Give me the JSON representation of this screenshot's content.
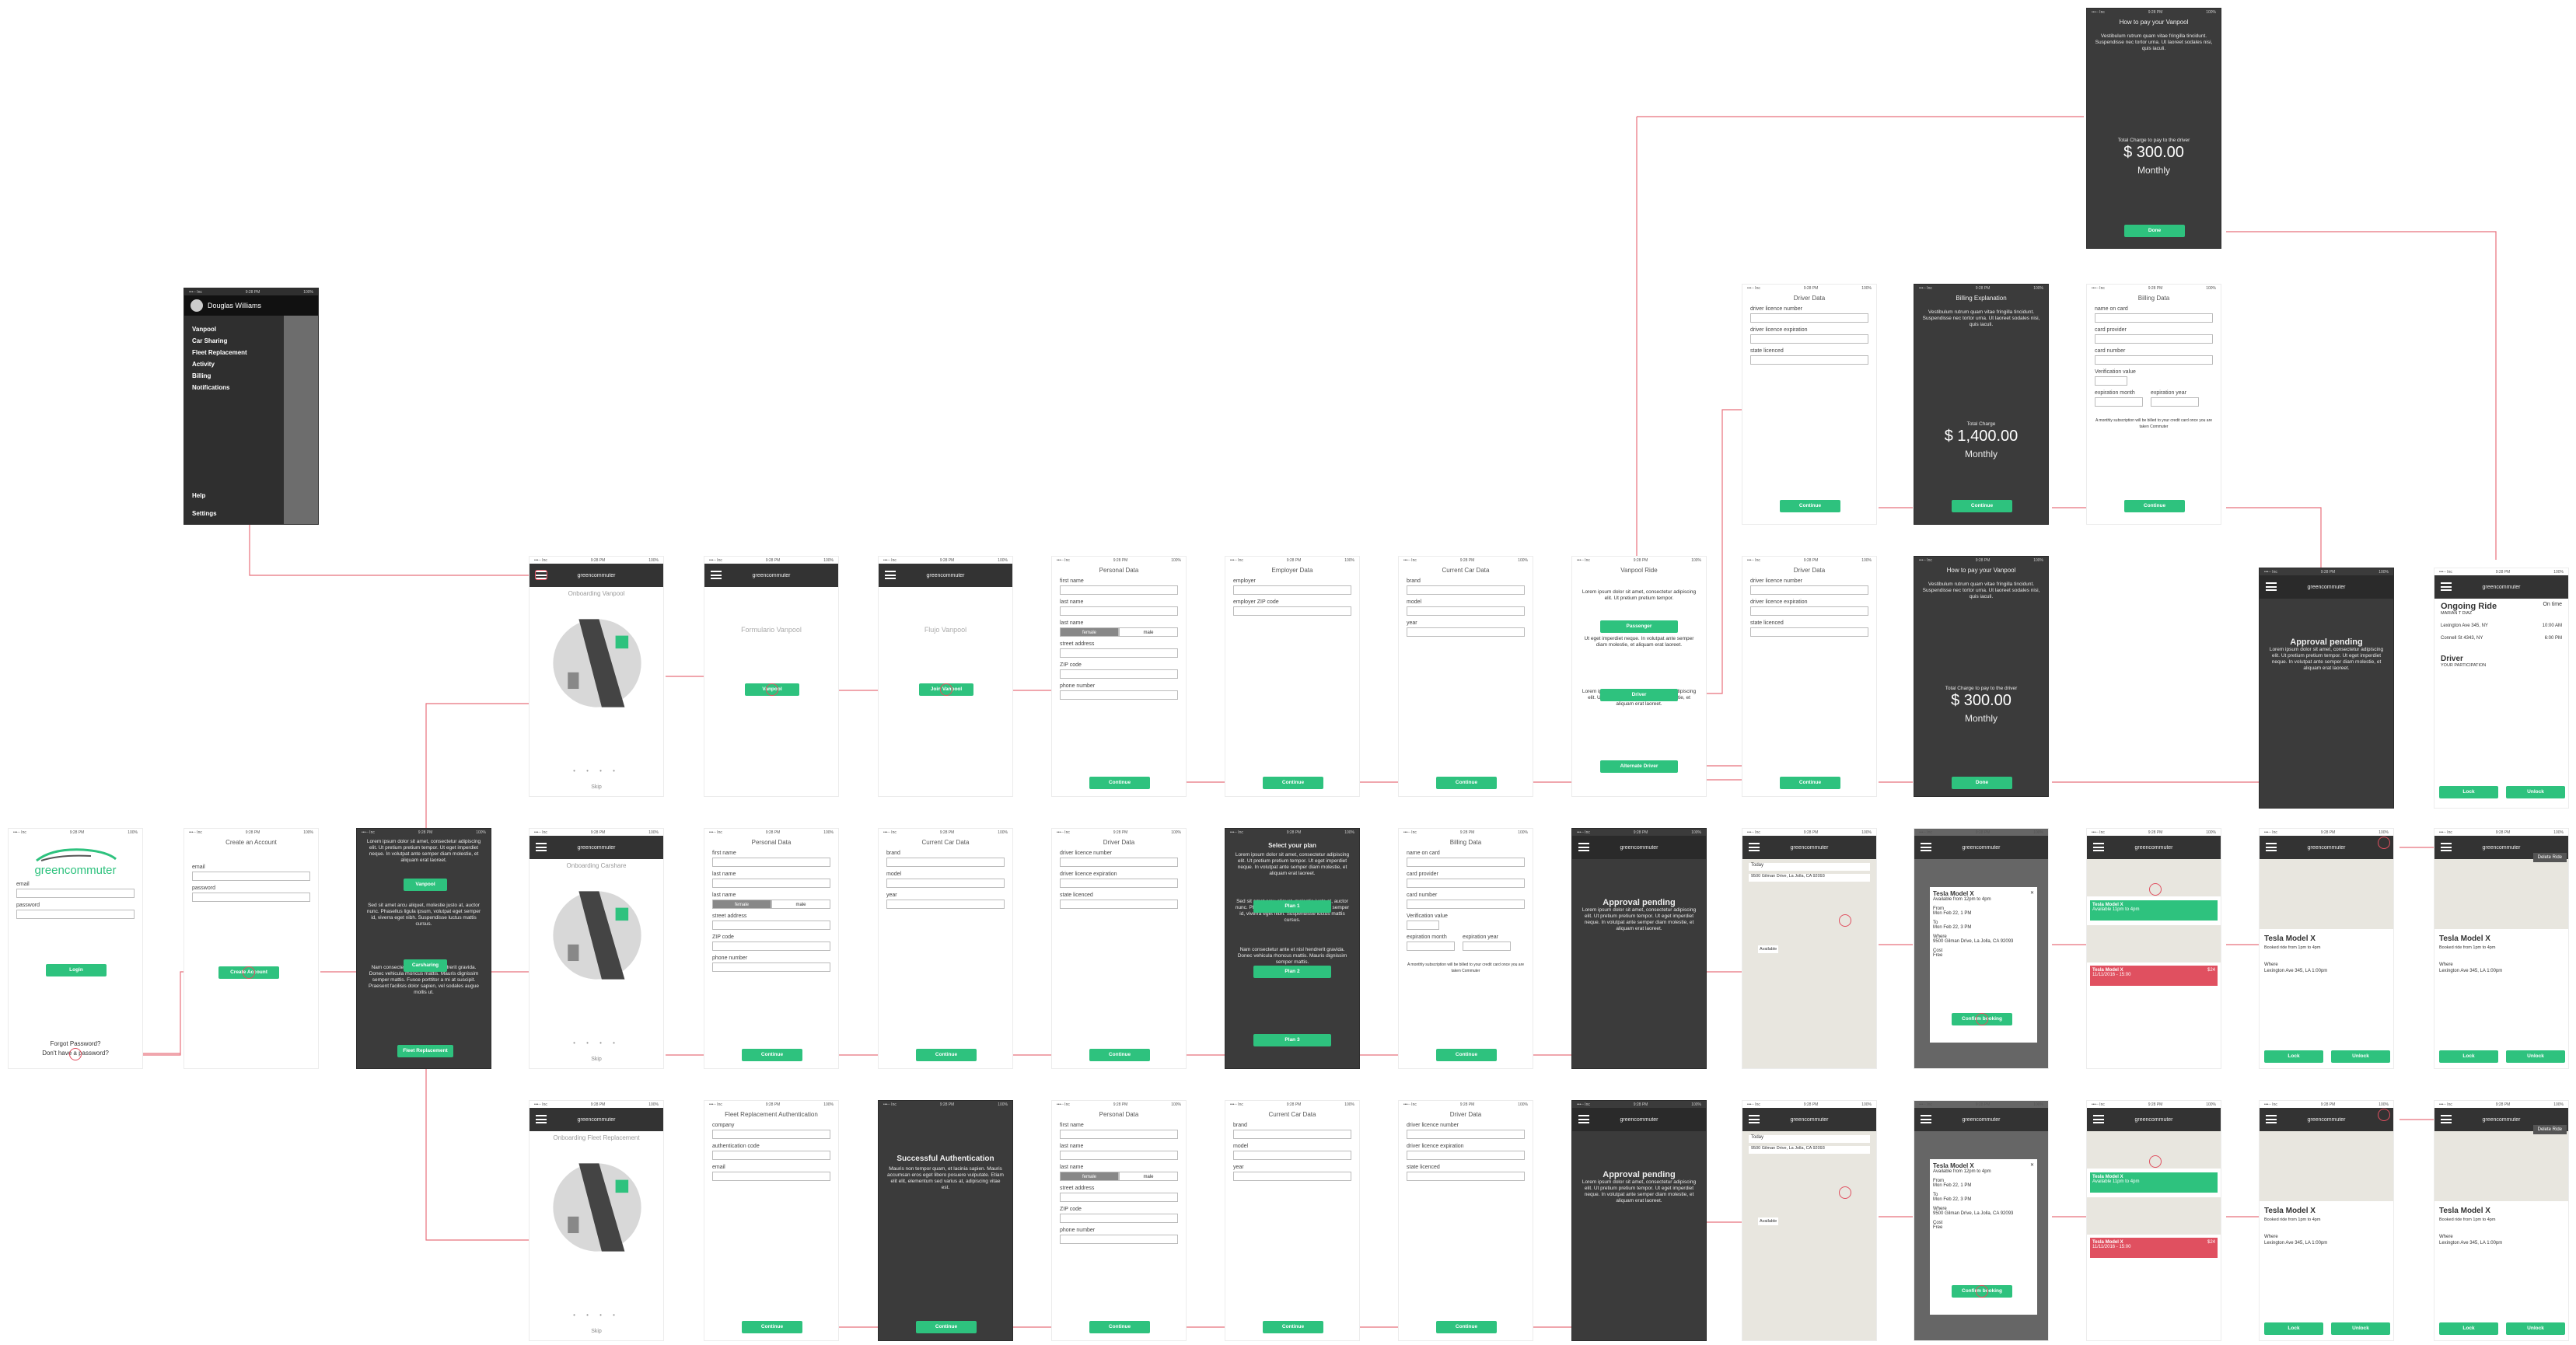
{
  "colors": {
    "accent": "#2ec27e",
    "connector": "#e8707c",
    "dark": "#3b3b3b"
  },
  "status": {
    "carrier": "•••◦◦ Inc",
    "time": "9:28 PM",
    "battery": "100%"
  },
  "common": {
    "app_name": "greencommuter",
    "continue": "Continue",
    "skip": "Skip",
    "dots": "• • • •"
  },
  "menu": {
    "user": "Douglas Williams",
    "items": [
      "Vanpool",
      "Car Sharing",
      "Fleet Replacement",
      "Activity",
      "Billing",
      "Notifications"
    ],
    "footer": [
      "Help",
      "Settings"
    ]
  },
  "login": {
    "brand": "greencommuter",
    "email": "email",
    "password": "password",
    "login_btn": "Login",
    "forgot": "Forgot Password?",
    "no_account": "Don't have a password?"
  },
  "create": {
    "title": "Create an Account",
    "email": "email",
    "password": "password",
    "btn": "Create Account"
  },
  "explain": {
    "p1": "Lorem ipsum dolor sit amet, consectetur adipiscing elit. Ut pretium pretium tempor. Ut eget imperdiet neque. In volutpat ante semper diam molestie, et aliquam erat laoreet.",
    "b1": "Vanpool",
    "p2": "Sed sit amet arcu aliquet, molestie justo at, auctor nunc. Phasellus ligula ipsum, volutpat eget semper id, viverra eget nibh. Suspendisse luctus mattis cursus.",
    "b2": "Carsharing",
    "p3": "Nam consectetur ante et nisl hendrerit gravida. Donec vehicula rhoncus mattis. Mauris dignissim semper mattis. Fusce porttitor a mi at suscipit. Praesent facilisis dolor sapien, vel sodales augue mollis ut.",
    "b3": "Fleet Replacement"
  },
  "onboarding": {
    "vanpool": "Onboarding Vanpool",
    "carshare": "Onboarding Carshare",
    "fleet": "Onboarding Fleet Replacement"
  },
  "formulario": {
    "label": "Formulario Vanpool",
    "btn": "Vanpool"
  },
  "flujo": {
    "label": "Flujo Vanpool",
    "btn": "Join Vanpool"
  },
  "personal": {
    "title": "Personal Data",
    "first": "first name",
    "last": "last name",
    "last2": "last name",
    "female": "female",
    "male": "male",
    "street": "street address",
    "zip": "ZIP code",
    "phone": "phone number"
  },
  "employer": {
    "title": "Employer Data",
    "employer": "employer",
    "zip": "employer ZIP code"
  },
  "car": {
    "title": "Current Car Data",
    "brand": "brand",
    "model": "model",
    "year": "year"
  },
  "vanride": {
    "title": "Vanpool Ride",
    "p1": "Lorem ipsum dolor sit amet, consectetur adipiscing elit. Ut pretium pretium tempor.",
    "b1": "Passenger",
    "p2": "Ut eget imperdiet neque. In volutpat ante semper diam molestie, et aliquam erat laoreet.",
    "b2": "Driver",
    "p3": "Lorem ipsum dolor sit amet, consectetur adipiscing elit. Ut volutpat ante semper diam molestie, et aliquam erat laoreet.",
    "b3": "Alternate Driver"
  },
  "driver": {
    "title": "Driver Data",
    "licence": "driver licence number",
    "expiration": "driver licence expiration",
    "state": "state licenced"
  },
  "billing": {
    "title": "Billing Data",
    "name": "name on card",
    "provider": "card provider",
    "number": "card number",
    "verification": "Verification value",
    "exp_month": "expiration month",
    "exp_year": "expiration year",
    "note": "A monthly subscription will be billed to your credit card once you are taken Commuter"
  },
  "bill_explain": {
    "title": "Billing Explanation",
    "p": "Vestibulum rutrum quam vitae fringilla tincidunt. Suspendisse nec tortor urna. Ut laoreet sodales nisi, quis iaculi.",
    "charge_lbl": "Total Charge",
    "amount": "$ 1,400.00",
    "period": "Monthly"
  },
  "pay": {
    "title": "How to pay your Vanpool",
    "p": "Vestibulum rutrum quam vitae fringilla tincidunt. Suspendisse nec tortor urna. Ut laoreet sodales nisi, quis iaculi.",
    "charge_lbl": "Total Charge to pay to the driver",
    "amount": "$ 300.00",
    "period": "Monthly",
    "btn": "Done"
  },
  "plan": {
    "title": "Select your plan",
    "p1": "Lorem ipsum dolor sit amet, consectetur adipiscing elit. Ut pretium pretium tempor. Ut eget imperdiet neque. In volutpat ante semper diam molestie, et aliquam erat laoreet.",
    "b1": "Plan 1",
    "p2": "Sed sit amet arcu aliquet, molestie justo at, auctor nunc. Phasellus ligula ipsum, volutpat eget semper id, viverra eget nibh. Suspendisse luctus mattis cursus.",
    "b2": "Plan 2",
    "p3": "Nam consectetur ante et nisl hendrerit gravida. Donec vehicula rhoncus mattis. Mauris dignissim semper mattis.",
    "b3": "Plan 3"
  },
  "approval": {
    "title": "Approval pending",
    "p": "Lorem ipsum dolor sit amet, consectetur adipiscing elit. Ut pretium pretium tempor. Ut eget imperdiet neque. In volutpat ante semper diam molestie, et aliquam erat laoreet."
  },
  "fleet_auth": {
    "title": "Fleet Replacement Authentication",
    "company": "company",
    "code": "authentication code",
    "email": "email"
  },
  "success": {
    "title": "Successful Authentication",
    "p": "Mauris non tempor quam, et lacinia sapien. Mauris accumsan eros eget libero posuere vulputate. Etiam elit elit, elementum sed varius at, adipiscing vitae est.",
    "btn": "Continue"
  },
  "maps": {
    "search": "Today",
    "address": "9500 Gilman Drive, La Jolla, CA 92093",
    "available": "Available"
  },
  "detail": {
    "car": "Tesla Model X",
    "avail": "Available from 12pm to 4pm",
    "from_lbl": "From",
    "from": "Mon Feb 22, 1 PM",
    "to_lbl": "To",
    "to": "Mon Feb 22, 3 PM",
    "where_lbl": "Where",
    "where": "9500 Gilman Drive, La Jolla, CA 92093",
    "cost_lbl": "Cost",
    "cost": "Free",
    "btn": "Confirm booking",
    "close": "✕"
  },
  "alerts": {
    "a1_car": "Tesla Model X",
    "a1_text": "Available 11pm to 4pm",
    "a2_car": "Tesla Model X",
    "a2_price": "$24",
    "a2_text": "11/11/2016 - 15:00"
  },
  "booked": {
    "car": "Tesla Model X",
    "sub": "Booked ride from 1pm to 4pm",
    "where_lbl": "Where",
    "where": "Lexington Ave 345, LA 1:00pm",
    "lock": "Lock",
    "unlock": "Unlock",
    "delete": "Delete Ride"
  },
  "ongoing": {
    "title": "Ongoing Ride",
    "state": "On time",
    "who": "MARIAN T DIAZ",
    "stop1": "Lexington Ave 345, NY",
    "t1": "10:00 AM",
    "stop2": "Connell St 4343, NY",
    "t2": "6:00 PM",
    "driver_lbl": "Driver",
    "driver_sub": "YOUR PARTICIPATION",
    "lock": "Lock",
    "unlock": "Unlock"
  }
}
